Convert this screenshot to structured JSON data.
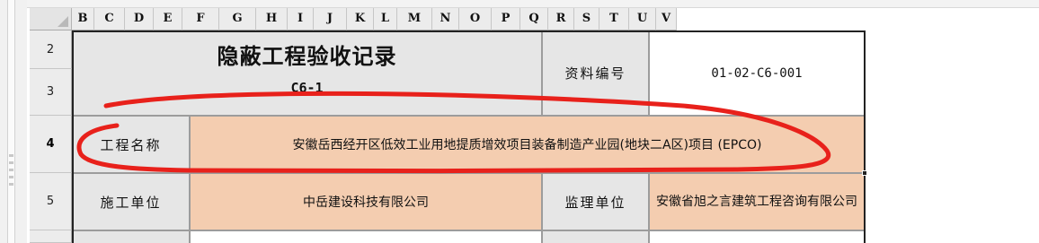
{
  "columns": [
    "B",
    "C",
    "D",
    "E",
    "F",
    "G",
    "H",
    "I",
    "J",
    "K",
    "L",
    "M",
    "N",
    "O",
    "P",
    "Q",
    "R",
    "S",
    "T",
    "U",
    "V"
  ],
  "rows": [
    "2",
    "3",
    "4",
    "5"
  ],
  "form": {
    "title": "隐蔽工程验收记录",
    "code": "C6-1",
    "doc_no_label": "资料编号",
    "doc_no_value": "01-02-C6-001",
    "project_label": "工程名称",
    "project_value": "安徽岳西经开区低效工业用地提质增效项目装备制造产业园(地块二A区)项目 (EPCO)",
    "contractor_label": "施工单位",
    "contractor_value": "中岳建设科技有限公司",
    "supervisor_label": "监理单位",
    "supervisor_value": "安徽省旭之言建筑工程咨询有限公司"
  },
  "colors": {
    "peach_fill": "#f4cdb0",
    "gray_fill": "#e6e6e6",
    "annotation_red": "#e8211b"
  }
}
